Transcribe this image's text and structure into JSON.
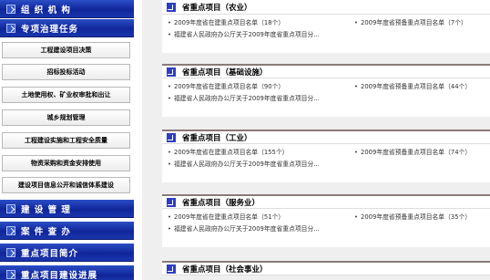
{
  "sidebar": {
    "sections": [
      {
        "label": "组 织 机 构"
      },
      {
        "label": "专项治理任务"
      }
    ],
    "sub_items": [
      {
        "label": "工程建设项目决策"
      },
      {
        "label": "招标投标活动"
      },
      {
        "label": "土地使用权、矿业权审批和出让"
      },
      {
        "label": "城乡规划管理"
      },
      {
        "label": "工程建设实施和工程安全质量"
      },
      {
        "label": "物资采购和资金安排使用"
      },
      {
        "label": "建设项目信息公开和诚信体系建设"
      }
    ],
    "bottom_sections": [
      {
        "label": "建 设 管 理"
      },
      {
        "label": "案 件 查 办"
      },
      {
        "label": "重点项目简介"
      },
      {
        "label": "重点项目建设进展"
      }
    ]
  },
  "content": {
    "sections": [
      {
        "title": "省重点项目（农业）",
        "link1": "2009年度省在建重点项目名单（18个）",
        "link2": "2009年度省预备重点项目名单（7个）",
        "link3": "福建省人民政府办公厅关于2009年度省重点项目分..."
      },
      {
        "title": "省重点项目（基础设施）",
        "link1": "2009年度省在建重点项目名单（90个）",
        "link2": "2009年度省预备重点项目名单（44个）",
        "link3": "福建省人民政府办公厅关于2009年度省重点项目分..."
      },
      {
        "title": "省重点项目（工业）",
        "link1": "2009年度省在建重点项目名单（155个）",
        "link2": "2009年度省预备重点项目名单（74个）",
        "link3": "福建省人民政府办公厅关于2009年度省重点项目分..."
      },
      {
        "title": "省重点项目（服务业）",
        "link1": "2009年度省在建重点项目名单（51个）",
        "link2": "2009年度省预备重点项目名单（35个）",
        "link3": "福建省人民政府办公厅关于2009年度省重点项目分..."
      },
      {
        "title": "省重点项目（社会事业）"
      }
    ]
  }
}
